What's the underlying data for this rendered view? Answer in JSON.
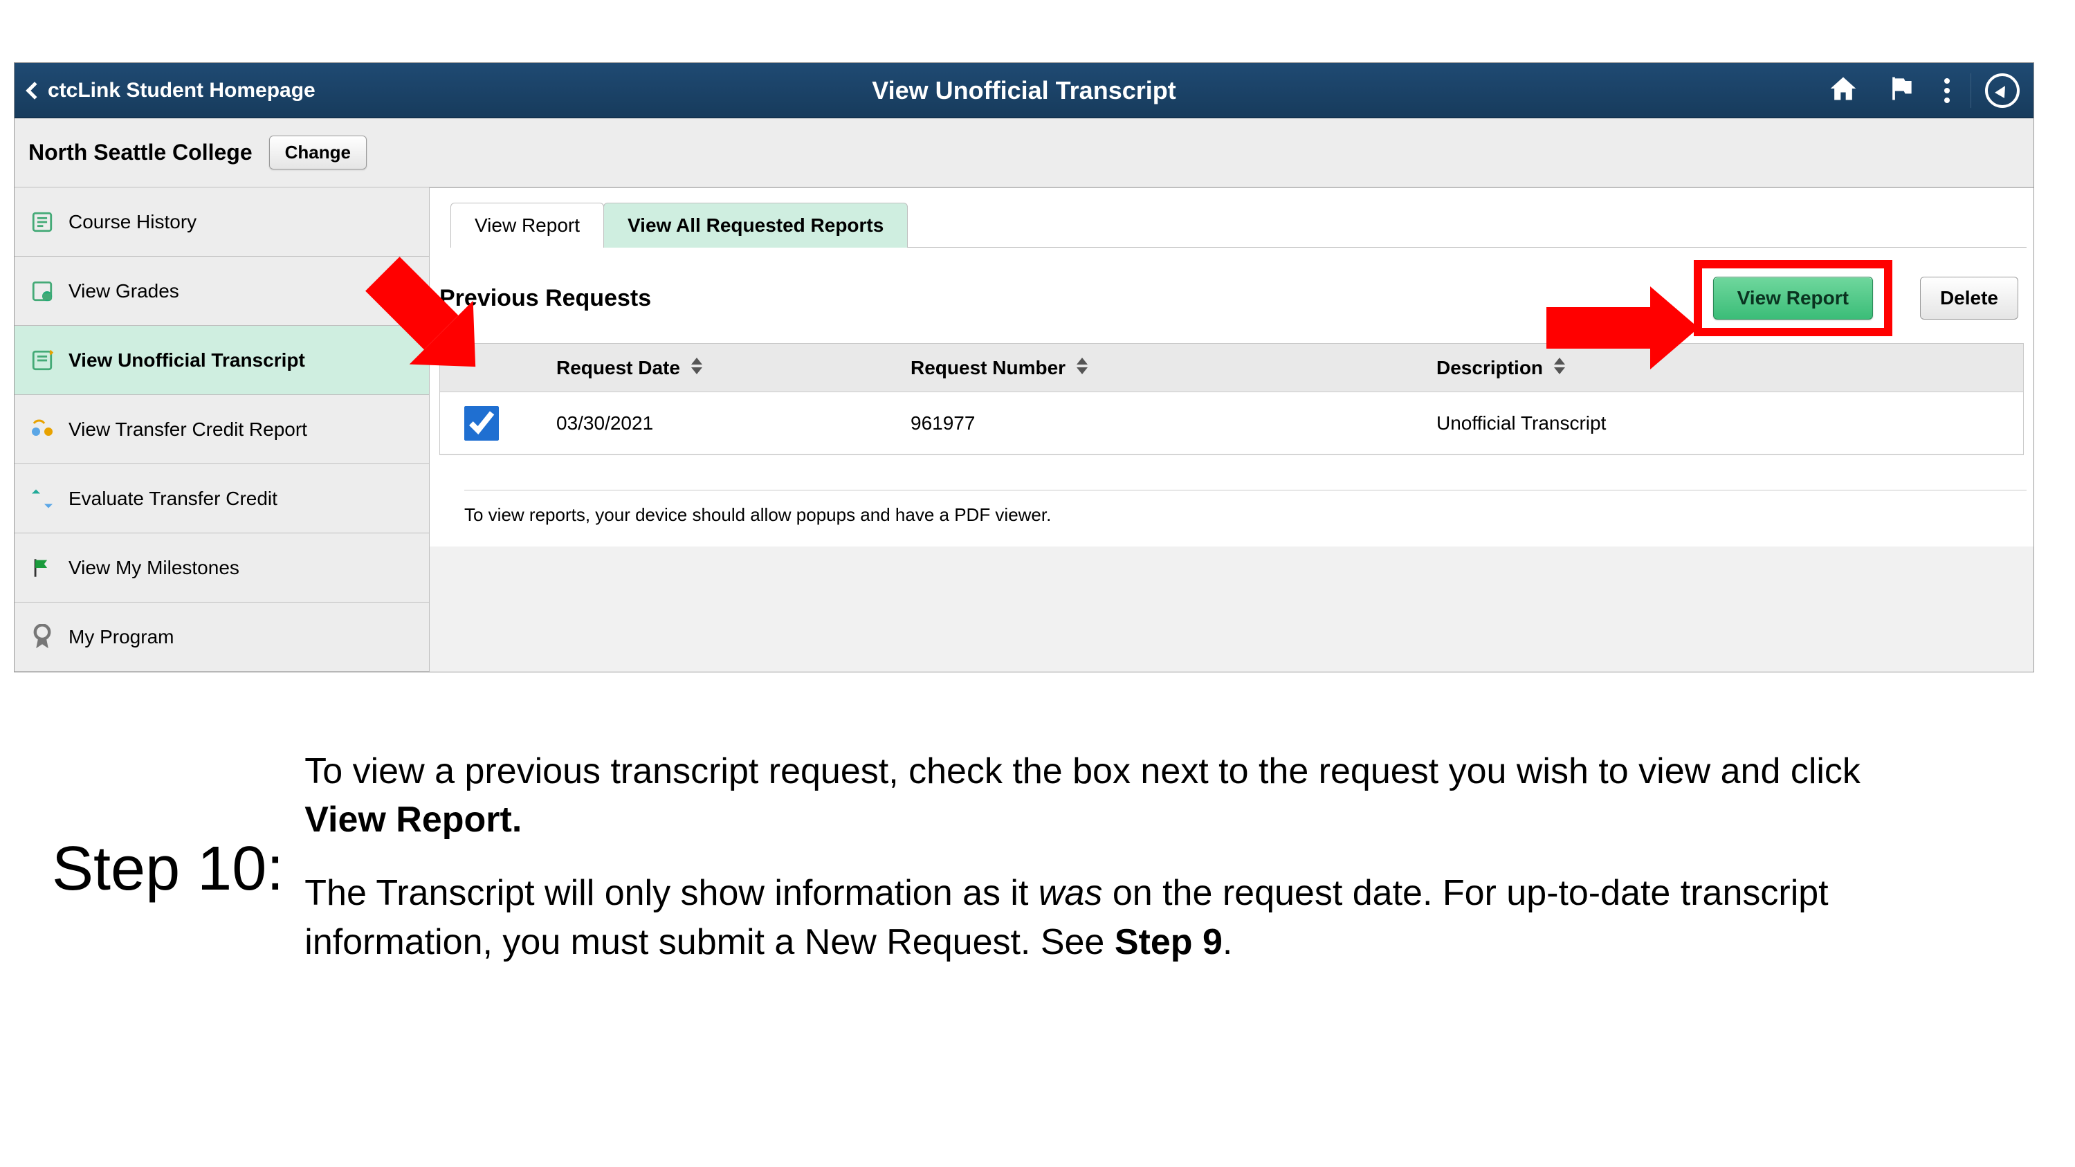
{
  "banner": {
    "back_label": "ctcLink Student Homepage",
    "title": "View Unofficial Transcript"
  },
  "subheader": {
    "college": "North Seattle College",
    "change_label": "Change"
  },
  "sidenav": {
    "items": [
      {
        "label": "Course History"
      },
      {
        "label": "View Grades"
      },
      {
        "label": "View Unofficial Transcript"
      },
      {
        "label": "View Transfer Credit Report"
      },
      {
        "label": "Evaluate Transfer Credit"
      },
      {
        "label": "View My Milestones"
      },
      {
        "label": "My Program"
      }
    ]
  },
  "tabs": {
    "view_report": "View Report",
    "view_all": "View All Requested Reports"
  },
  "section": {
    "title": "Previous Requests",
    "view_report_btn": "View Report",
    "delete_btn": "Delete"
  },
  "table": {
    "headers": {
      "date": "Request Date",
      "number": "Request Number",
      "desc": "Description"
    },
    "rows": [
      {
        "date": "03/30/2021",
        "number": "961977",
        "desc": "Unofficial Transcript",
        "checked": true
      }
    ]
  },
  "hint": "To view reports, your device should allow popups and have a PDF viewer.",
  "instructions": {
    "step_label": "Step 10:",
    "p1a": "To view a previous transcript request, check the box next to the request you wish to view and click ",
    "p1b": "View Report.",
    "p2a": "The Transcript will only show information as it ",
    "p2b": "was",
    "p2c": " on the request date. For up-to-date transcript information, you must submit a New Request. See ",
    "p2d": "Step 9",
    "p2e": "."
  }
}
